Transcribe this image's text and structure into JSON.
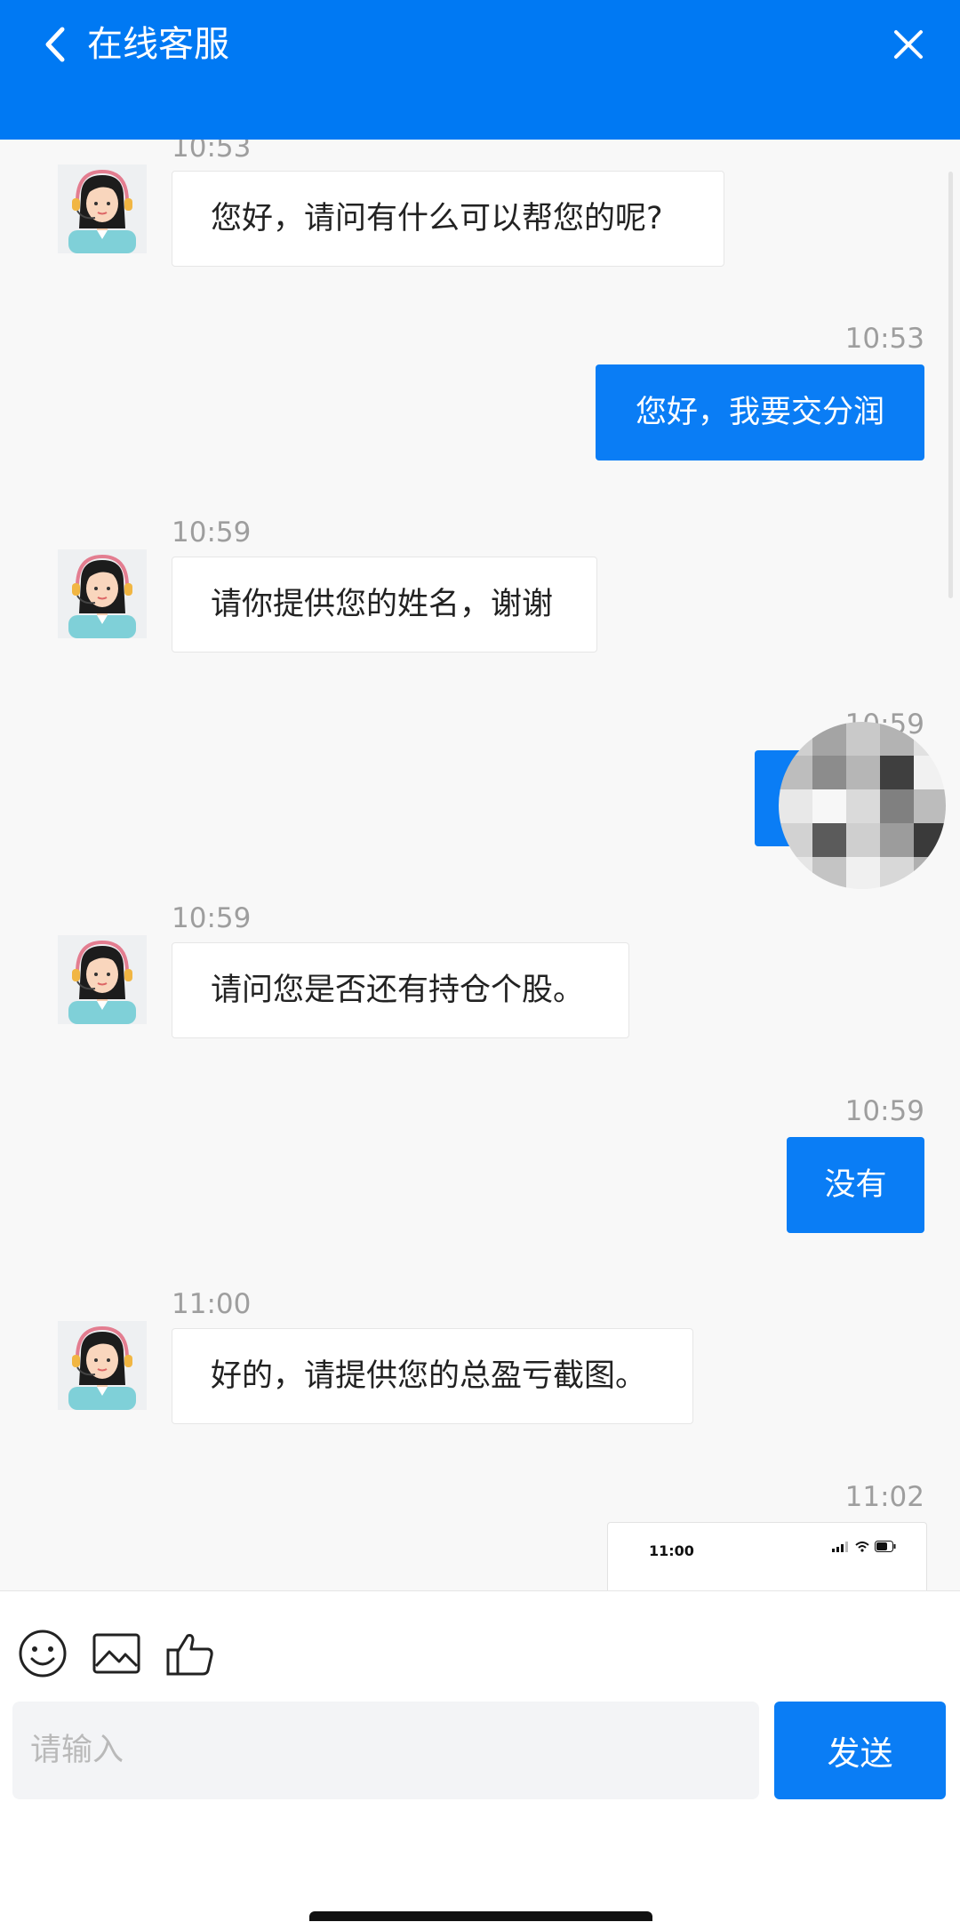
{
  "header": {
    "title": "在线客服",
    "background": "#0079f3"
  },
  "messages": [
    {
      "side": "in",
      "time": "10:53",
      "text": "您好，请问有什么可以帮您的呢?"
    },
    {
      "side": "out",
      "time": "10:53",
      "text": "您好，我要交分润"
    },
    {
      "side": "in",
      "time": "10:59",
      "text": "请你提供您的姓名，谢谢"
    },
    {
      "side": "out",
      "time": "10:59",
      "text": ""
    },
    {
      "side": "in",
      "time": "10:59",
      "text": "请问您是否还有持仓个股。"
    },
    {
      "side": "out",
      "time": "10:59",
      "text": "没有"
    },
    {
      "side": "in",
      "time": "11:00",
      "text": "好的，请提供您的总盈亏截图。"
    },
    {
      "side": "out",
      "time": "11:02",
      "image": {
        "status_time": "11:00"
      }
    }
  ],
  "composer": {
    "placeholder": "请输入",
    "value": "",
    "send_label": "发送",
    "tools": [
      "smile-icon",
      "image-icon",
      "thumbs-up-icon"
    ]
  },
  "colors": {
    "accent": "#0a7df5",
    "chat_background": "#f8f8f8",
    "timestamp": "#9e9e9e"
  }
}
